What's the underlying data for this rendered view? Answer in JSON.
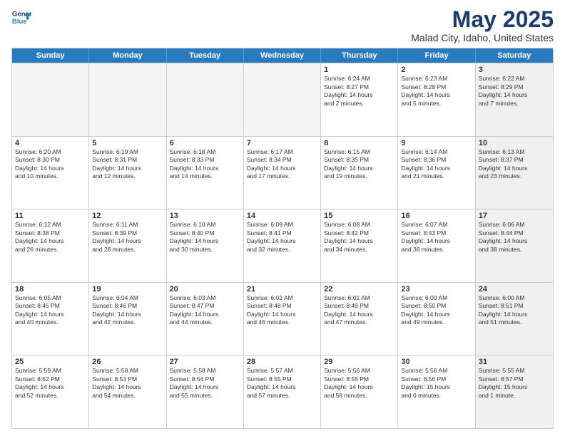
{
  "logo": {
    "line1": "General",
    "line2": "Blue"
  },
  "title": "May 2025",
  "subtitle": "Malad City, Idaho, United States",
  "days": [
    "Sunday",
    "Monday",
    "Tuesday",
    "Wednesday",
    "Thursday",
    "Friday",
    "Saturday"
  ],
  "rows": [
    [
      {
        "num": "",
        "empty": true
      },
      {
        "num": "",
        "empty": true
      },
      {
        "num": "",
        "empty": true
      },
      {
        "num": "",
        "empty": true
      },
      {
        "num": "1",
        "text": "Sunrise: 6:24 AM\nSunset: 8:27 PM\nDaylight: 14 hours\nand 2 minutes."
      },
      {
        "num": "2",
        "text": "Sunrise: 6:23 AM\nSunset: 8:28 PM\nDaylight: 14 hours\nand 5 minutes."
      },
      {
        "num": "3",
        "shaded": true,
        "text": "Sunrise: 6:22 AM\nSunset: 8:29 PM\nDaylight: 14 hours\nand 7 minutes."
      }
    ],
    [
      {
        "num": "4",
        "text": "Sunrise: 6:20 AM\nSunset: 8:30 PM\nDaylight: 14 hours\nand 10 minutes."
      },
      {
        "num": "5",
        "text": "Sunrise: 6:19 AM\nSunset: 8:31 PM\nDaylight: 14 hours\nand 12 minutes."
      },
      {
        "num": "6",
        "text": "Sunrise: 6:18 AM\nSunset: 8:33 PM\nDaylight: 14 hours\nand 14 minutes."
      },
      {
        "num": "7",
        "text": "Sunrise: 6:17 AM\nSunset: 8:34 PM\nDaylight: 14 hours\nand 17 minutes."
      },
      {
        "num": "8",
        "text": "Sunrise: 6:15 AM\nSunset: 8:35 PM\nDaylight: 14 hours\nand 19 minutes."
      },
      {
        "num": "9",
        "text": "Sunrise: 6:14 AM\nSunset: 8:36 PM\nDaylight: 14 hours\nand 21 minutes."
      },
      {
        "num": "10",
        "shaded": true,
        "text": "Sunrise: 6:13 AM\nSunset: 8:37 PM\nDaylight: 14 hours\nand 23 minutes."
      }
    ],
    [
      {
        "num": "11",
        "text": "Sunrise: 6:12 AM\nSunset: 8:38 PM\nDaylight: 14 hours\nand 26 minutes."
      },
      {
        "num": "12",
        "text": "Sunrise: 6:11 AM\nSunset: 8:39 PM\nDaylight: 14 hours\nand 28 minutes."
      },
      {
        "num": "13",
        "text": "Sunrise: 6:10 AM\nSunset: 8:40 PM\nDaylight: 14 hours\nand 30 minutes."
      },
      {
        "num": "14",
        "text": "Sunrise: 6:09 AM\nSunset: 8:41 PM\nDaylight: 14 hours\nand 32 minutes."
      },
      {
        "num": "15",
        "text": "Sunrise: 6:08 AM\nSunset: 8:42 PM\nDaylight: 14 hours\nand 34 minutes."
      },
      {
        "num": "16",
        "text": "Sunrise: 6:07 AM\nSunset: 8:43 PM\nDaylight: 14 hours\nand 36 minutes."
      },
      {
        "num": "17",
        "shaded": true,
        "text": "Sunrise: 6:06 AM\nSunset: 8:44 PM\nDaylight: 14 hours\nand 38 minutes."
      }
    ],
    [
      {
        "num": "18",
        "text": "Sunrise: 6:05 AM\nSunset: 8:45 PM\nDaylight: 14 hours\nand 40 minutes."
      },
      {
        "num": "19",
        "text": "Sunrise: 6:04 AM\nSunset: 8:46 PM\nDaylight: 14 hours\nand 42 minutes."
      },
      {
        "num": "20",
        "text": "Sunrise: 6:03 AM\nSunset: 8:47 PM\nDaylight: 14 hours\nand 44 minutes."
      },
      {
        "num": "21",
        "text": "Sunrise: 6:02 AM\nSunset: 8:48 PM\nDaylight: 14 hours\nand 46 minutes."
      },
      {
        "num": "22",
        "text": "Sunrise: 6:01 AM\nSunset: 8:49 PM\nDaylight: 14 hours\nand 47 minutes."
      },
      {
        "num": "23",
        "text": "Sunrise: 6:00 AM\nSunset: 8:50 PM\nDaylight: 14 hours\nand 49 minutes."
      },
      {
        "num": "24",
        "shaded": true,
        "text": "Sunrise: 6:00 AM\nSunset: 8:51 PM\nDaylight: 14 hours\nand 51 minutes."
      }
    ],
    [
      {
        "num": "25",
        "text": "Sunrise: 5:59 AM\nSunset: 8:52 PM\nDaylight: 14 hours\nand 52 minutes."
      },
      {
        "num": "26",
        "text": "Sunrise: 5:58 AM\nSunset: 8:53 PM\nDaylight: 14 hours\nand 54 minutes."
      },
      {
        "num": "27",
        "text": "Sunrise: 5:58 AM\nSunset: 8:54 PM\nDaylight: 14 hours\nand 55 minutes."
      },
      {
        "num": "28",
        "text": "Sunrise: 5:57 AM\nSunset: 8:55 PM\nDaylight: 14 hours\nand 57 minutes."
      },
      {
        "num": "29",
        "text": "Sunrise: 5:56 AM\nSunset: 8:55 PM\nDaylight: 14 hours\nand 58 minutes."
      },
      {
        "num": "30",
        "text": "Sunrise: 5:56 AM\nSunset: 8:56 PM\nDaylight: 15 hours\nand 0 minutes."
      },
      {
        "num": "31",
        "shaded": true,
        "text": "Sunrise: 5:55 AM\nSunset: 8:57 PM\nDaylight: 15 hours\nand 1 minute."
      }
    ]
  ]
}
